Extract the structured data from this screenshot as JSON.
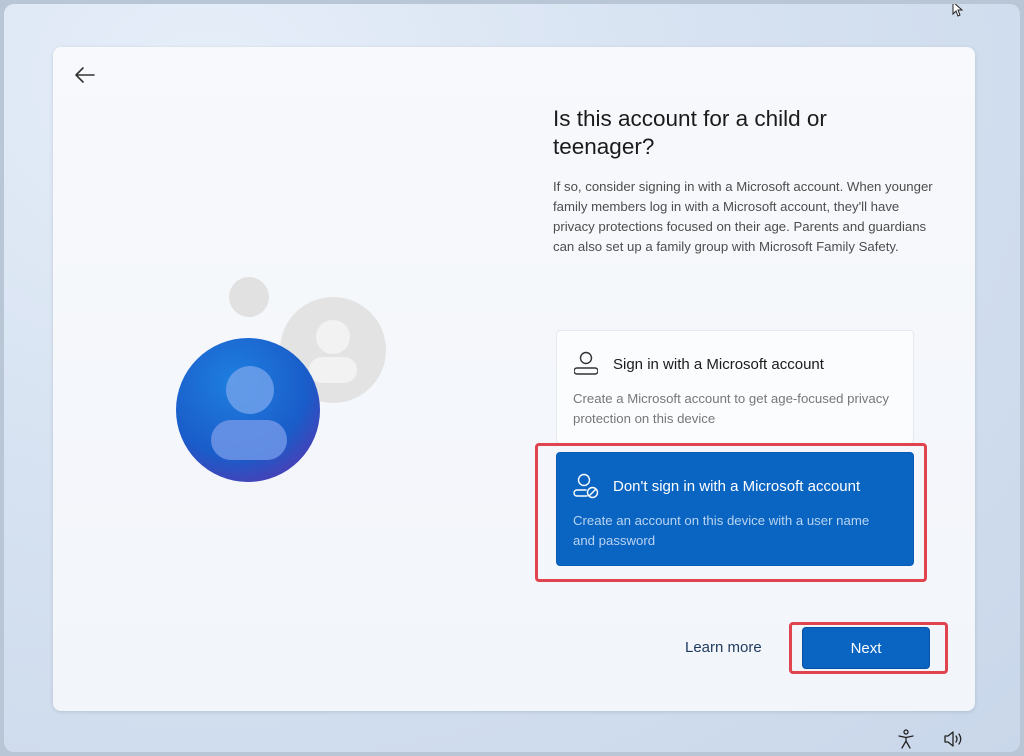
{
  "page": {
    "title": "Is this account for a child or teenager?",
    "description": "If so, consider signing in with a Microsoft account. When younger family members log in with a Microsoft account, they'll have privacy protections focused on their age. Parents and guardians can also set up a family group with Microsoft Family Safety."
  },
  "options": [
    {
      "title": "Sign in with a Microsoft account",
      "subtitle": "Create a Microsoft account to get age-focused privacy protection on this device",
      "icon": "person-icon",
      "selected": false
    },
    {
      "title": "Don't sign in with a Microsoft account",
      "subtitle": "Create an account on this device with a user name and password",
      "icon": "person-blocked-icon",
      "selected": true
    }
  ],
  "footer": {
    "learn_more": "Learn more",
    "next": "Next"
  },
  "colors": {
    "accent": "#0a64c2",
    "highlight": "#e0454f"
  },
  "tray": [
    "accessibility-icon",
    "volume-icon"
  ]
}
